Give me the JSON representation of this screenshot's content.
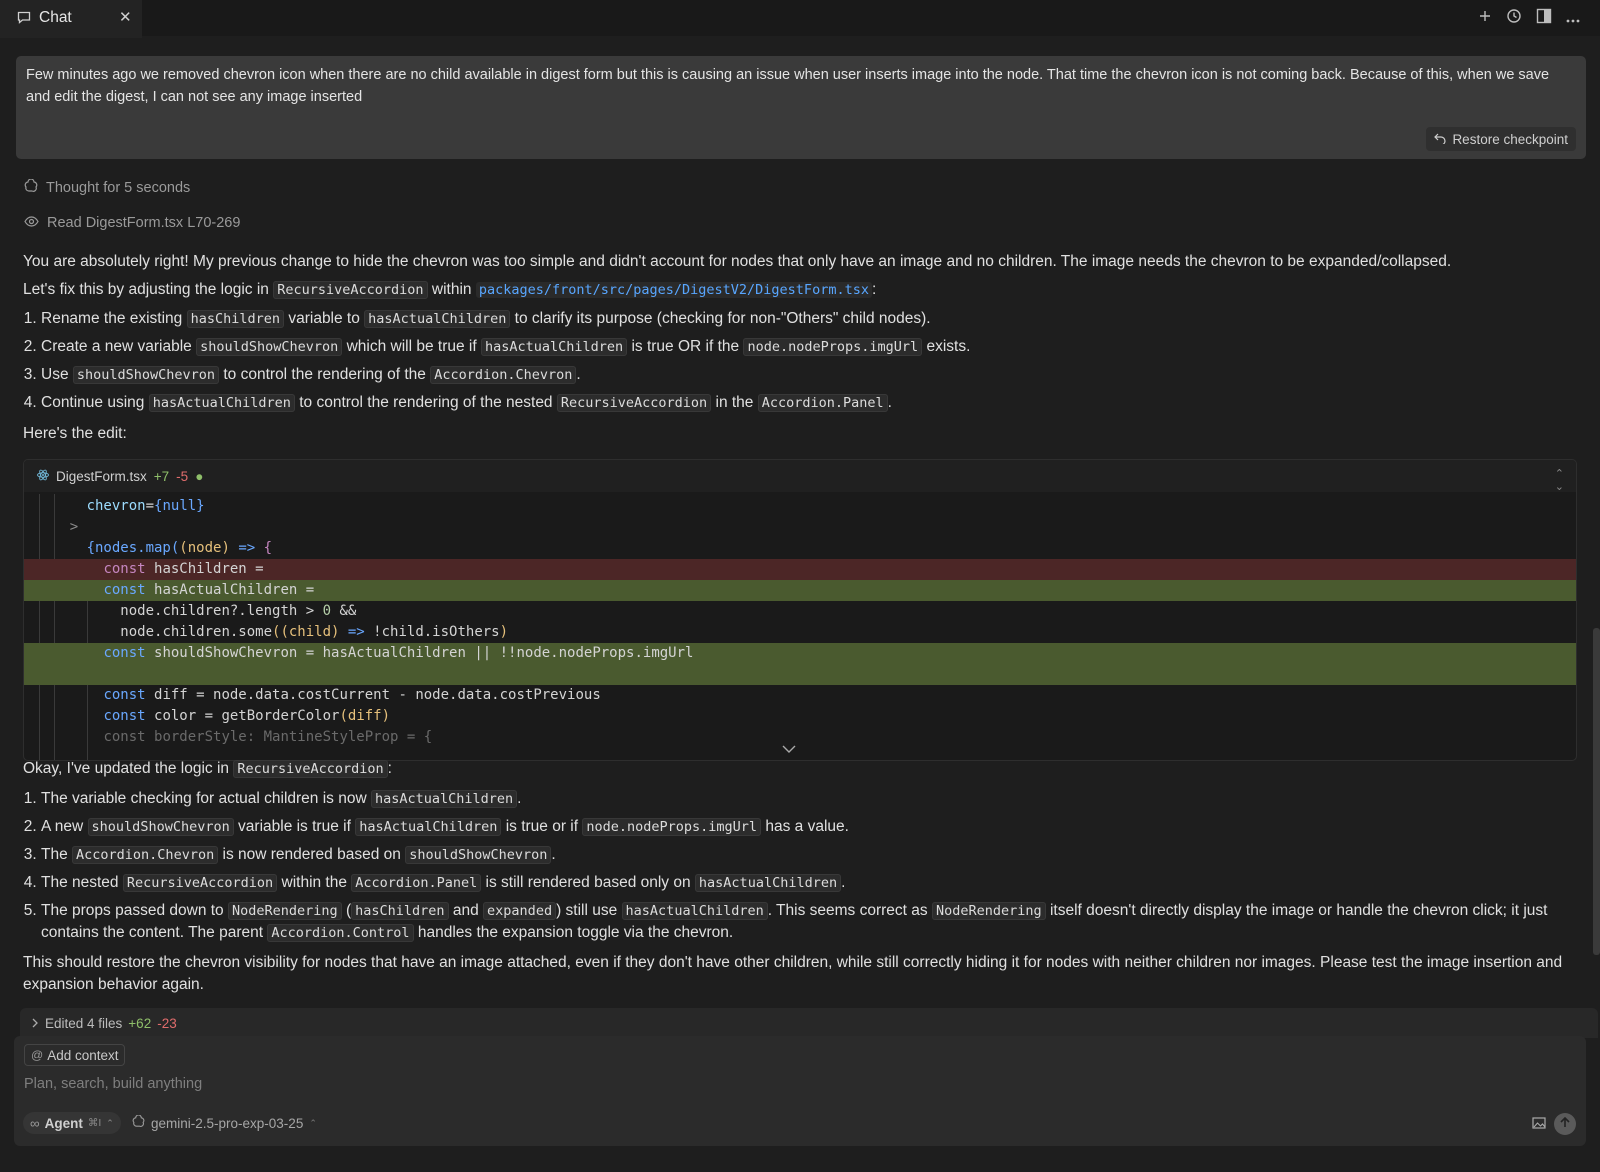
{
  "tab": {
    "label": "Chat",
    "close": "✕"
  },
  "user_message": {
    "text": "Few minutes ago we removed chevron icon when there are no child available in digest form but this is causing an issue when user inserts image into the node. That time the chevron icon is not coming back. Because of this, when we save and edit the digest, I can not see any image inserted",
    "restore_label": "Restore checkpoint"
  },
  "thought": {
    "label": "Thought for 5 seconds"
  },
  "read": {
    "label": "Read DigestForm.tsx L70-269"
  },
  "response": {
    "intro": "You are absolutely right! My previous change to hide the chevron was too simple and didn't account for nodes that only have an image and no children. The image needs the chevron to be expanded/collapsed.",
    "fix_prefix": "Let's fix this by adjusting the logic in",
    "fix_code": "RecursiveAccordion",
    "fix_within": "within",
    "fix_path": "packages/front/src/pages/DigestV2/DigestForm.tsx",
    "fix_colon": ":",
    "steps": [
      {
        "a": "Rename the existing",
        "c1": "hasChildren",
        "b": "variable to",
        "c2": "hasActualChildren",
        "d": "to clarify its purpose (checking for non-\"Others\" child nodes)."
      },
      {
        "a": "Create a new variable",
        "c1": "shouldShowChevron",
        "b": "which will be true if",
        "c2": "hasActualChildren",
        "d": "is true OR if the",
        "c3": "node.nodeProps.imgUrl",
        "e": "exists."
      },
      {
        "a": "Use",
        "c1": "shouldShowChevron",
        "b": "to control the rendering of the",
        "c2": "Accordion.Chevron",
        "d": "."
      },
      {
        "a": "Continue using",
        "c1": "hasActualChildren",
        "b": "to control the rendering of the nested",
        "c2": "RecursiveAccordion",
        "d": "in the",
        "c3": "Accordion.Panel",
        "e": "."
      }
    ],
    "heres_edit": "Here's the edit:",
    "updated_prefix": "Okay, I've updated the logic in",
    "updated_code": "RecursiveAccordion",
    "updated_colon": ":",
    "summary": [
      {
        "a": "The variable checking for actual children is now",
        "c1": "hasActualChildren",
        "b": "."
      },
      {
        "a": "A new",
        "c1": "shouldShowChevron",
        "b": "variable is true if",
        "c2": "hasActualChildren",
        "d": "is true or if",
        "c3": "node.nodeProps.imgUrl",
        "e": "has a value."
      },
      {
        "a": "The",
        "c1": "Accordion.Chevron",
        "b": "is now rendered based on",
        "c2": "shouldShowChevron",
        "d": "."
      },
      {
        "a": "The nested",
        "c1": "RecursiveAccordion",
        "b": "within the",
        "c2": "Accordion.Panel",
        "d": "is still rendered based only on",
        "c3": "hasActualChildren",
        "e": "."
      },
      {
        "a": "The props passed down to",
        "c1": "NodeRendering",
        "b": "(",
        "c2": "hasChildren",
        "d": "and",
        "c3": "expanded",
        "e": ") still use",
        "c4": "hasActualChildren",
        "f": ". This seems correct as",
        "c5": "NodeRendering",
        "g": "itself doesn't directly display the image or handle the chevron click; it just contains the content. The parent",
        "c6": "Accordion.Control",
        "h": "handles the expansion toggle via the chevron."
      }
    ],
    "closing": "This should restore the chevron visibility for nodes that have an image attached, even if they don't have other children, while still correctly hiding it for nodes with neither children nor images. Please test the image insertion and expansion behavior again."
  },
  "code_block": {
    "filename": "DigestForm.tsx",
    "added": "+7",
    "removed": "-5",
    "lines": {
      "l1_prop": "chevron",
      "l1_val": "{null}",
      "l2": ">",
      "l3_open": "{nodes.map(",
      "l3_arg": "(node)",
      "l3_arrow": "=>",
      "l3_brace": "{",
      "l4_kw": "const",
      "l4_rest": " hasChildren =",
      "l5_kw": "const",
      "l5_rest": " hasActualChildren =",
      "l6_a": "node.children?.length > ",
      "l6_num": "0",
      "l6_b": " &&",
      "l7_a": "node.children.some",
      "l7_arg": "((child)",
      "l7_arrow": " => ",
      "l7_b": "!child.isOthers",
      "l7_close": ")",
      "l8_kw": "const",
      "l8_rest": " shouldShowChevron = hasActualChildren || !!node.nodeProps.imgUrl",
      "l10_kw": "const",
      "l10_rest": " diff = node.data.costCurrent - node.data.costPrevious",
      "l11_kw": "const",
      "l11_rest": " color = getBorderColor",
      "l11_arg": "(diff)",
      "l12": "const borderStyle: MantineStyleProp = {"
    }
  },
  "edited_bar": {
    "label": "Edited 4 files",
    "added": "+62",
    "removed": "-23"
  },
  "composer": {
    "add_context": "Add context",
    "placeholder": "Plan, search, build anything",
    "agent_label": "Agent",
    "agent_shortcut": "⌘I",
    "model_label": "gemini-2.5-pro-exp-03-25"
  }
}
